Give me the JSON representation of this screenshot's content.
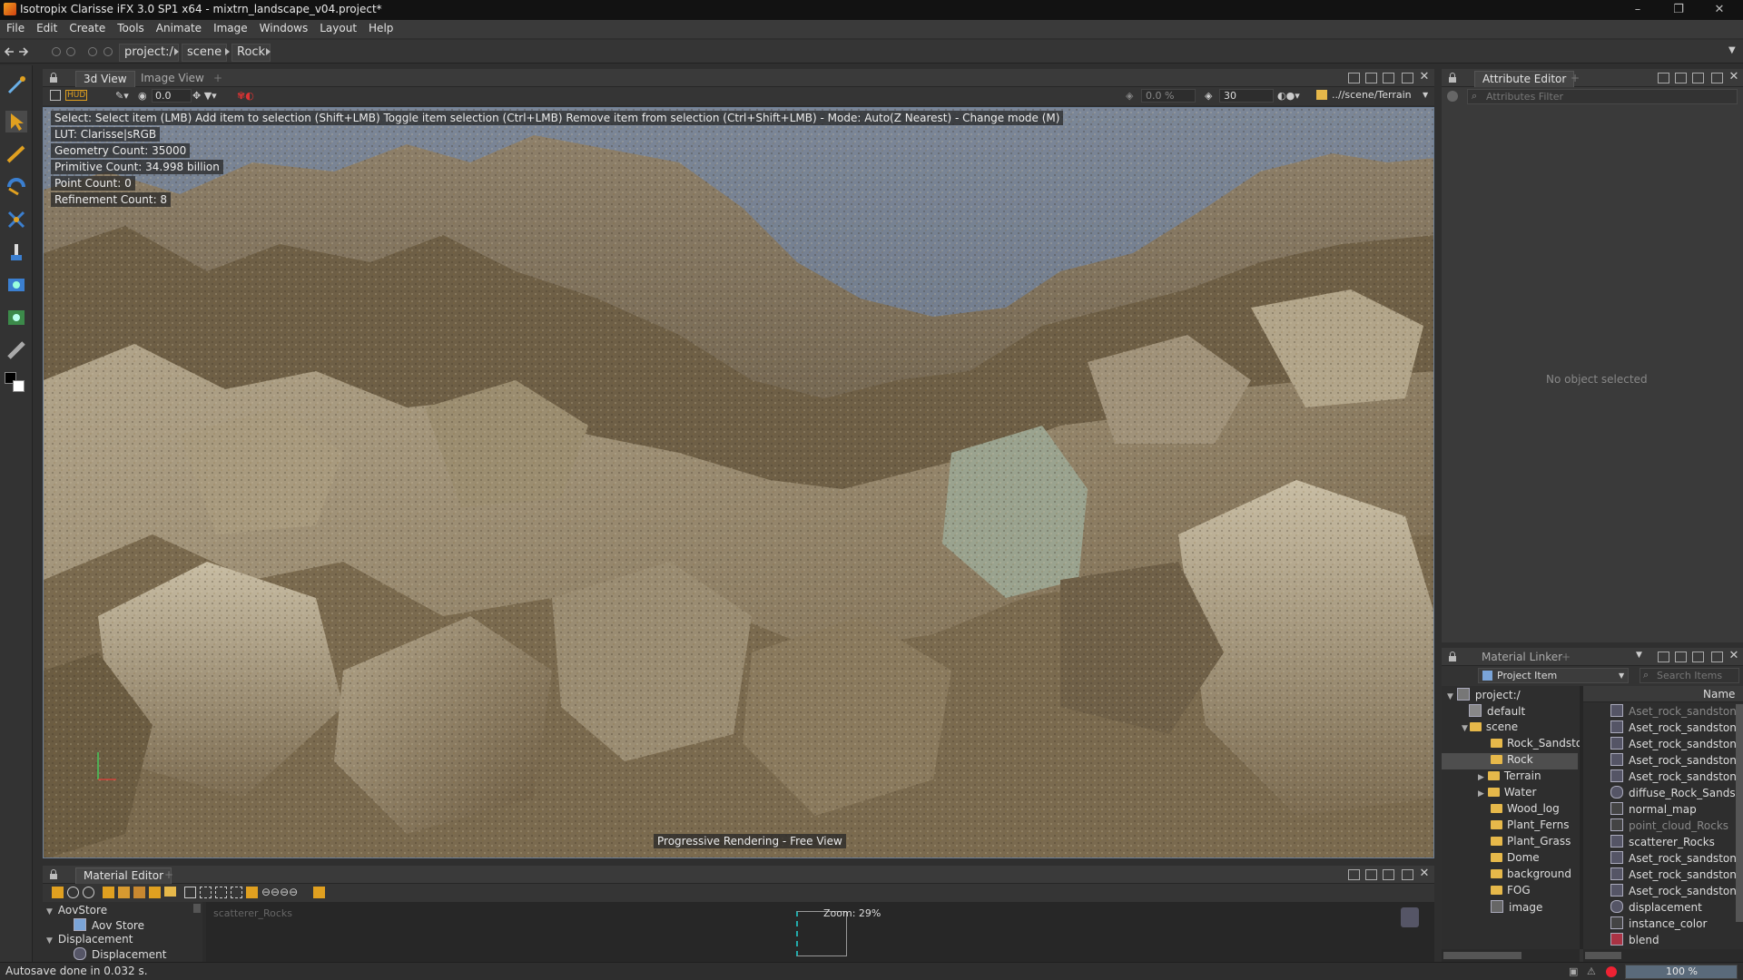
{
  "window": {
    "title": "Isotropix Clarisse iFX 3.0 SP1 x64 - mixtrn_landscape_v04.project*",
    "minimize": "–",
    "maximize": "❐",
    "close": "✕"
  },
  "menu": [
    "File",
    "Edit",
    "Create",
    "Tools",
    "Animate",
    "Image",
    "Windows",
    "Layout",
    "Help"
  ],
  "breadcrumb": [
    "project:/",
    "scene",
    "Rock"
  ],
  "viewport_panel": {
    "tabs": [
      "3d View",
      "Image View"
    ],
    "add_tab": "+",
    "hud_label": "HUD",
    "exposure_value": "0.0",
    "percent_value": "0.0 %",
    "fps_value": "30",
    "path": "..//scene/Terrain"
  },
  "viewport": {
    "help_text": "Select: Select item (LMB)  Add item to selection (Shift+LMB)  Toggle item selection (Ctrl+LMB)  Remove item from selection (Ctrl+Shift+LMB)  - Mode: Auto(Z Nearest) - Change mode (M)",
    "lut": "LUT: Clarisse|sRGB",
    "geometry_count": "Geometry Count: 35000",
    "primitive_count": "Primitive Count: 34.998 billion",
    "point_count": "Point Count: 0",
    "refinement_count": "Refinement Count: 8",
    "render_status": "Progressive Rendering - Free View"
  },
  "attribute_editor": {
    "tab": "Attribute Editor",
    "add_tab": "+",
    "filter_placeholder": "Attributes Filter",
    "empty_message": "No object selected"
  },
  "material_linker": {
    "tab": "Material Linker",
    "add_tab": "+",
    "dropdown": "Project Item",
    "search_placeholder": "Search Items",
    "column_name": "Name",
    "tree": [
      {
        "label": "project:/",
        "depth": 0,
        "expanded": true
      },
      {
        "label": "default",
        "depth": 1,
        "expanded": false
      },
      {
        "label": "scene",
        "depth": 1,
        "expanded": true
      },
      {
        "label": "Rock_Sandsto",
        "depth": 2,
        "expanded": false
      },
      {
        "label": "Rock",
        "depth": 2,
        "expanded": false,
        "selected": true
      },
      {
        "label": "Terrain",
        "depth": 2,
        "expanded": false,
        "has_children": true
      },
      {
        "label": "Water",
        "depth": 2,
        "expanded": false,
        "has_children": true
      },
      {
        "label": "Wood_log",
        "depth": 2,
        "expanded": false
      },
      {
        "label": "Plant_Ferns",
        "depth": 2,
        "expanded": false
      },
      {
        "label": "Plant_Grass",
        "depth": 2,
        "expanded": false
      },
      {
        "label": "Dome",
        "depth": 2,
        "expanded": false
      },
      {
        "label": "background",
        "depth": 2,
        "expanded": false
      },
      {
        "label": "FOG",
        "depth": 2,
        "expanded": false
      },
      {
        "label": "image",
        "depth": 2,
        "expanded": false
      }
    ],
    "items": [
      {
        "label": "Aset_rock_sandstone_",
        "dim": true
      },
      {
        "label": "Aset_rock_sandstone_",
        "dim": false
      },
      {
        "label": "Aset_rock_sandstone_",
        "dim": false
      },
      {
        "label": "Aset_rock_sandstone_",
        "dim": false
      },
      {
        "label": "Aset_rock_sandstone_",
        "dim": false
      },
      {
        "label": "diffuse_Rock_Sandsto",
        "dim": false
      },
      {
        "label": "normal_map",
        "dim": false
      },
      {
        "label": "point_cloud_Rocks",
        "dim": true
      },
      {
        "label": "scatterer_Rocks",
        "dim": false
      },
      {
        "label": "Aset_rock_sandstone",
        "dim": false
      },
      {
        "label": "Aset_rock_sandstone",
        "dim": false
      },
      {
        "label": "Aset_rock_sandstone_",
        "dim": false
      },
      {
        "label": "displacement",
        "dim": false
      },
      {
        "label": "instance_color",
        "dim": false
      },
      {
        "label": "blend",
        "dim": false
      }
    ]
  },
  "material_editor": {
    "tab": "Material Editor",
    "add_tab": "+",
    "tree": [
      {
        "label": "AovStore",
        "depth": 0
      },
      {
        "label": "Aov Store",
        "depth": 1
      },
      {
        "label": "Displacement",
        "depth": 0
      },
      {
        "label": "Displacement",
        "depth": 1
      }
    ],
    "node_label": "scatterer_Rocks",
    "zoom": "Zoom: 29%"
  },
  "status": {
    "message": "Autosave done in 0.032 s.",
    "zoom": "100 %"
  },
  "colors": {
    "accent": "#e0a020",
    "viewport_border": "#6d7f97",
    "sky": "#6f7a8a"
  }
}
